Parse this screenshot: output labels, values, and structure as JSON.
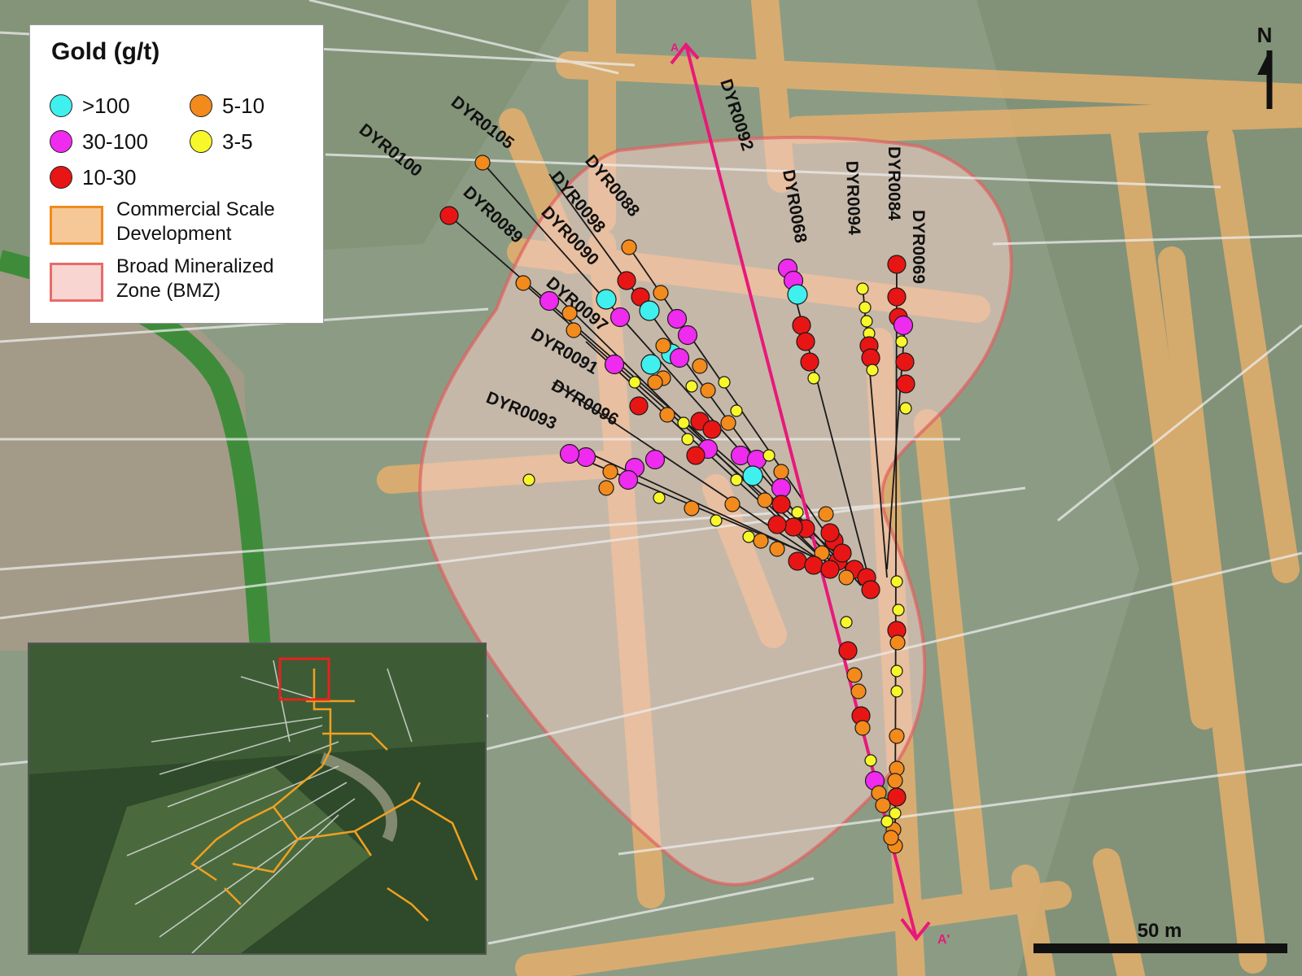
{
  "legend": {
    "title": "Gold (g/t)",
    "grades": [
      {
        "label": ">100",
        "color": "#3ff0ef"
      },
      {
        "label": "5-10",
        "color": "#f28a1c"
      },
      {
        "label": "30-100",
        "color": "#ee2bee"
      },
      {
        "label": "3-5",
        "color": "#f7f72a"
      },
      {
        "label": "10-30",
        "color": "#e81515"
      }
    ],
    "zones": [
      {
        "label_line1": "Commercial Scale",
        "label_line2": "Development",
        "fill": "#f6c898",
        "stroke": "#f08a1c"
      },
      {
        "label_line1": "Broad Mineralized",
        "label_line2": "Zone (BMZ)",
        "fill": "#f8d5d0",
        "stroke": "#e86a6a"
      }
    ]
  },
  "section_line": {
    "start_label": "A",
    "end_label": "A'",
    "color": "#e8197a"
  },
  "north_arrow": {
    "label": "N"
  },
  "scale_bar": {
    "label": "50 m"
  },
  "drillholes": [
    {
      "label": "DYR0100"
    },
    {
      "label": "DYR0105"
    },
    {
      "label": "DYR0089"
    },
    {
      "label": "DYR0088"
    },
    {
      "label": "DYR0098"
    },
    {
      "label": "DYR0090"
    },
    {
      "label": "DYR0097"
    },
    {
      "label": "DYR0091"
    },
    {
      "label": "DYR0096"
    },
    {
      "label": "DYR0093"
    },
    {
      "label": "DYR0092"
    },
    {
      "label": "DYR0068"
    },
    {
      "label": "DYR0094"
    },
    {
      "label": "DYR0084"
    },
    {
      "label": "DYR0069"
    }
  ],
  "inset": {
    "highlight_color": "#e82020"
  }
}
